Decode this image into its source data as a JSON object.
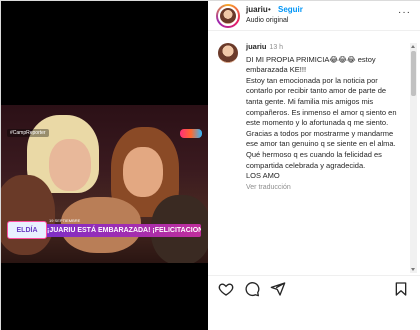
{
  "header": {
    "username": "juariu",
    "separator": "•",
    "follow_label": "Seguir",
    "audio_label": "Audio original",
    "more_label": "···"
  },
  "caption": {
    "username": "juariu",
    "time": "13 h",
    "text": "DI MI PROPIA PRIMICIA😂😂😂 estoy embarazada KE!!!\nEstoy tan emocionada por la noticia por contarlo por recibir tanto amor de parte de tanta gente. Mi familia mis amigos mis compañeros. Es inmenso el amor q siento en este momento y lo afortunada q me siento. Gracias a todos por mostrarme y mandarme ese amor tan genuino q se siente en el alma. Qué hermoso q es cuando la felicidad es compartida celebrada y agradecida.\nLOS AMO",
    "translate_label": "Ver traducción"
  },
  "video": {
    "top_tag": "#CampReporter",
    "lower_logo": "ELDÍA",
    "lower_date": "19 SEPTIEMBRE",
    "lower_headline": "¡JUARIU ESTÁ EMBARAZADA! ¡FELICITACIONES!"
  },
  "actions": {
    "icons": [
      "heart-icon",
      "comment-icon",
      "share-icon",
      "bookmark-icon"
    ]
  }
}
